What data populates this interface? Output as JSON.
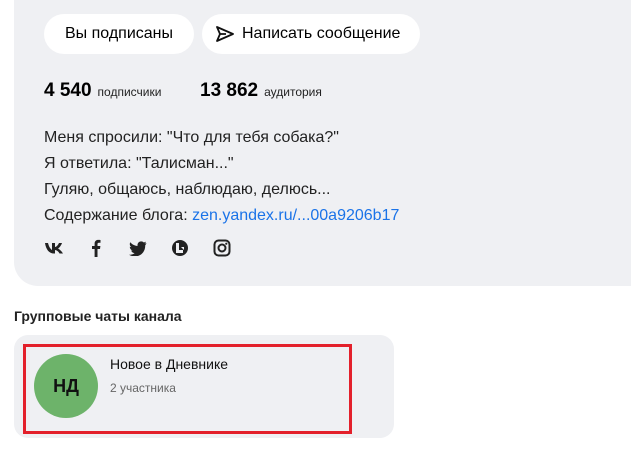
{
  "buttons": {
    "subscribed": "Вы подписаны",
    "message": "Написать сообщение"
  },
  "stats": [
    {
      "value": "4 540",
      "label": "подписчики"
    },
    {
      "value": "13 862",
      "label": "аудитория"
    }
  ],
  "bio": {
    "line1": "Меня спросили: \"Что для тебя собака?\"",
    "line2": "Я ответила: \"Талисман...\"",
    "line3": "Гуляю, общаюсь, наблюдаю, делюсь...",
    "line4_prefix": "Содержание блога: ",
    "line4_link": "zen.yandex.ru/...00a9206b17"
  },
  "socials": [
    "vk-icon",
    "facebook-icon",
    "twitter-icon",
    "livejournal-icon",
    "instagram-icon"
  ],
  "group_chats": {
    "title": "Групповые чаты канала",
    "items": [
      {
        "initials": "НД",
        "name": "Новое в Дневнике",
        "members": "2 участника"
      }
    ]
  },
  "colors": {
    "card_bg": "#eff0f3",
    "link": "#1a73e8",
    "highlight": "#e3202b",
    "avatar": "#6db36a"
  }
}
